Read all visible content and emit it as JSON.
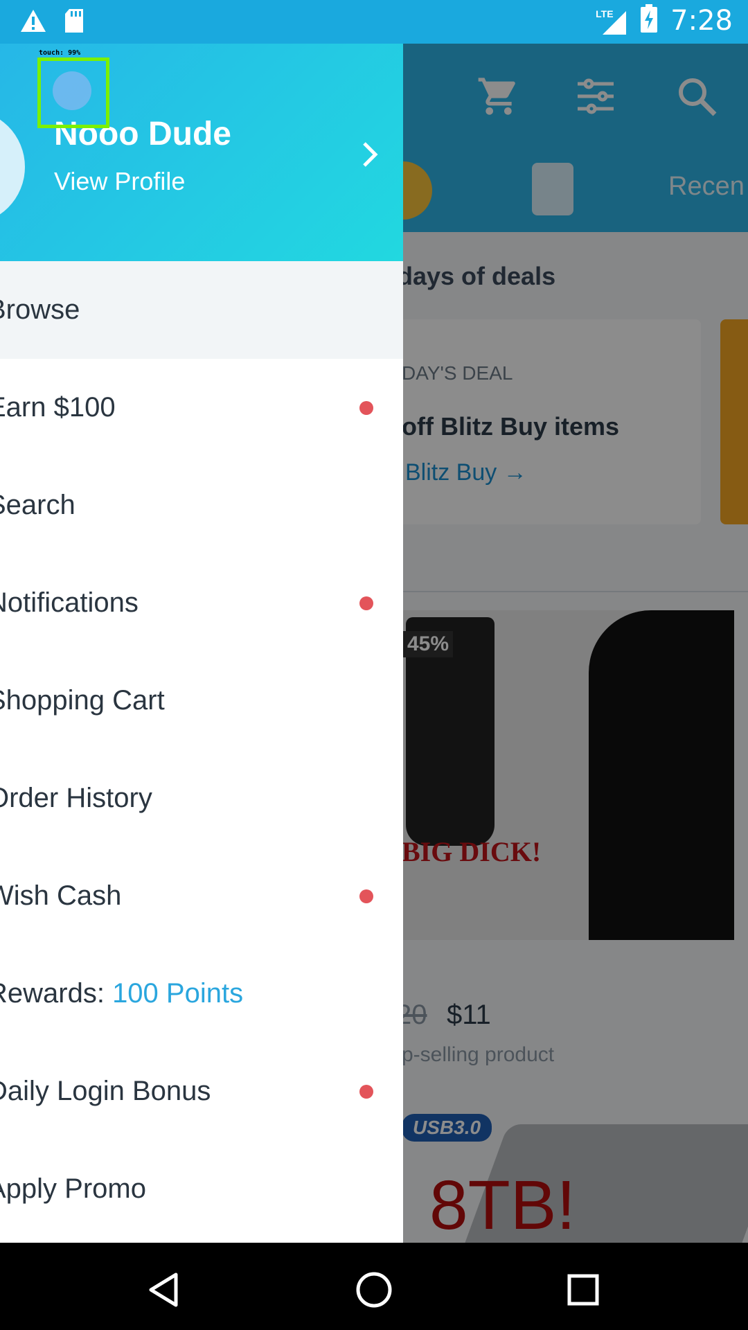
{
  "status_bar": {
    "time": "7:28",
    "network": "LTE",
    "icons": [
      "warning-icon",
      "sd-card-icon",
      "signal-icon",
      "battery-charging-icon"
    ]
  },
  "background_app": {
    "toolbar_icons": [
      "cart-icon",
      "filter-icon",
      "search-icon"
    ],
    "tab_label": "Recen",
    "section_title": "days of deals",
    "deal_tag": "DAY'S DEAL",
    "deal_title": "off Blitz Buy items",
    "deal_link": "Blitz Buy →",
    "product": {
      "badge": "45%",
      "headline": "BIG DICK!",
      "old_price": "20",
      "new_price": "$11",
      "subtitle": "p-selling product"
    },
    "second_product": {
      "badge": "USB3.0",
      "headline": "8TB!"
    }
  },
  "drawer": {
    "profile": {
      "name": "Nooo Dude",
      "link": "View Profile"
    },
    "touch_overlay": "touch: 99%",
    "items": [
      {
        "label": "Browse",
        "active": true,
        "dot": false
      },
      {
        "label": "Earn $100",
        "active": false,
        "dot": true
      },
      {
        "label": "Search",
        "active": false,
        "dot": false
      },
      {
        "label": "Notifications",
        "active": false,
        "dot": true
      },
      {
        "label": "Shopping Cart",
        "active": false,
        "dot": false
      },
      {
        "label": "Order History",
        "active": false,
        "dot": false
      },
      {
        "label": "Wish Cash",
        "active": false,
        "dot": true
      },
      {
        "label": "Rewards: ",
        "accent": "100 Points",
        "active": false,
        "dot": false
      },
      {
        "label": "Daily Login Bonus",
        "active": false,
        "dot": true
      },
      {
        "label": "Apply Promo",
        "active": false,
        "dot": false
      }
    ]
  },
  "nav_bar": {
    "buttons": [
      "back-icon",
      "home-icon",
      "recents-icon"
    ]
  },
  "colors": {
    "status_bar": "#1aa9de",
    "header_start": "#26b7e7",
    "header_end": "#22d8e0",
    "accent": "#2aa6de",
    "dot": "#e3545a"
  }
}
